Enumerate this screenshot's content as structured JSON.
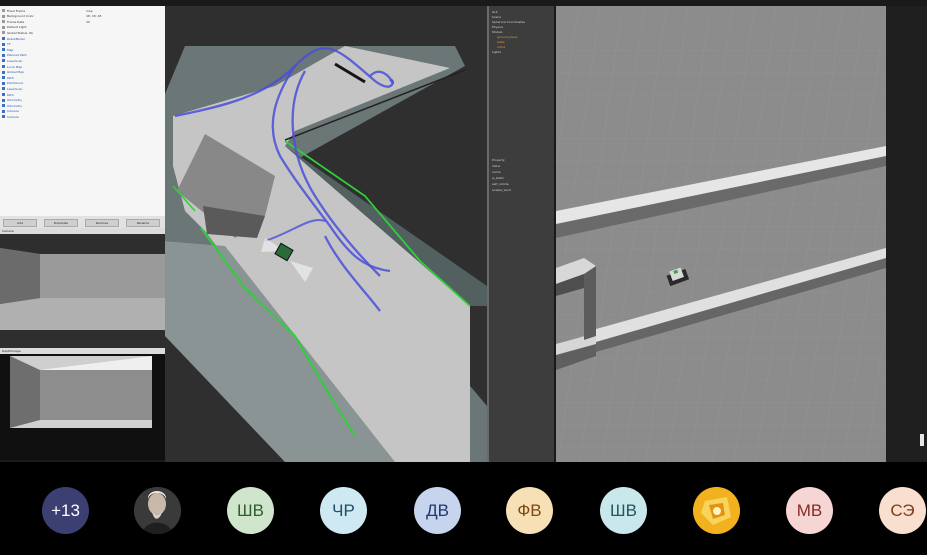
{
  "rviz": {
    "tree": [
      {
        "label": "Fixed Frame",
        "value": "map"
      },
      {
        "label": "Background Color",
        "value": "48; 48; 48"
      },
      {
        "label": "Frame Rate",
        "value": "30"
      },
      {
        "label": "Default Light",
        "value": ""
      },
      {
        "label": "Global Status: Ok",
        "value": ""
      },
      {
        "label": "RobotModel",
        "value": ""
      },
      {
        "label": "TF",
        "value": ""
      },
      {
        "label": "Map",
        "value": ""
      },
      {
        "label": "Planned Path",
        "value": ""
      },
      {
        "label": "LaserScan",
        "value": ""
      },
      {
        "label": "Local Map",
        "value": ""
      },
      {
        "label": "Global Map",
        "value": ""
      },
      {
        "label": "Path",
        "value": ""
      },
      {
        "label": "PointCloud",
        "value": ""
      },
      {
        "label": "LaserScan",
        "value": ""
      },
      {
        "label": "Path",
        "value": ""
      },
      {
        "label": "Odometry",
        "value": ""
      },
      {
        "label": "Odometry",
        "value": ""
      },
      {
        "label": "Camera",
        "value": ""
      },
      {
        "label": "Camera",
        "value": ""
      }
    ],
    "buttons": [
      "Add",
      "Duplicate",
      "Remove",
      "Rename"
    ],
    "camera1_title": "Camera",
    "camera2_title": "DepthImage"
  },
  "gazebo": {
    "tree": [
      "GUI",
      "Scene",
      "Spherical Coordinates",
      "Physics",
      "Models",
      "ground_plane",
      "walls",
      "robot",
      "Lights"
    ],
    "props": [
      "Property",
      "Value",
      "name",
      "is_static",
      "self_collide",
      "enable_wind"
    ]
  },
  "participants": [
    {
      "id": "more",
      "label": "+13",
      "bg": "#3b3f72",
      "fg": "#ffffff"
    },
    {
      "id": "photo",
      "label": "",
      "bg": "#3a3a3a",
      "fg": "#ffffff"
    },
    {
      "id": "sv1",
      "label": "ШВ",
      "bg": "#cfe6cc",
      "fg": "#2f5c2c"
    },
    {
      "id": "chr",
      "label": "ЧР",
      "bg": "#cfe9f2",
      "fg": "#1e4f63"
    },
    {
      "id": "dv",
      "label": "ДВ",
      "bg": "#c7d4ee",
      "fg": "#23386e"
    },
    {
      "id": "fv",
      "label": "ФВ",
      "bg": "#f7dfb6",
      "fg": "#7a4a12"
    },
    {
      "id": "sv2",
      "label": "ШВ",
      "bg": "#c9e8ec",
      "fg": "#21575e"
    },
    {
      "id": "gold",
      "label": "",
      "bg": "#f2b21f",
      "fg": "#ffffff"
    },
    {
      "id": "mv",
      "label": "МВ",
      "bg": "#f6d6d4",
      "fg": "#8a2a24"
    },
    {
      "id": "se",
      "label": "СЭ",
      "bg": "#f9dfcf",
      "fg": "#7e3c19"
    }
  ],
  "colors": {
    "path": "#4a4fd8",
    "laser": "#2fcf3a",
    "gazebo_ground": "#8c8c8c"
  }
}
